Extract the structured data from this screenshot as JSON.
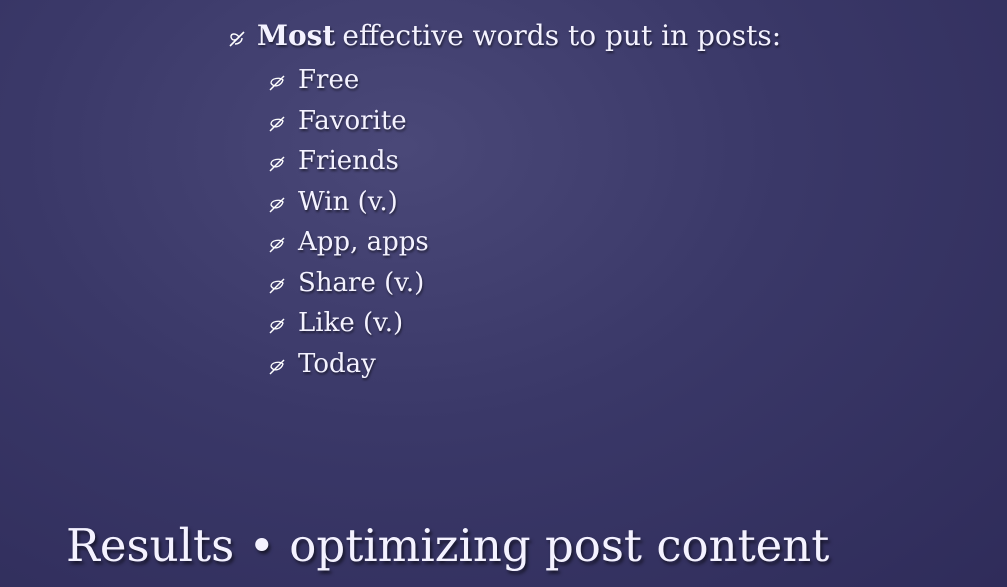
{
  "bullet": {
    "icon": "leaf-bullet-icon",
    "emphasis": "Most",
    "text": "effective words to put in posts:"
  },
  "sub_bullets": [
    {
      "icon": "leaf-bullet-icon",
      "text": "Free"
    },
    {
      "icon": "leaf-bullet-icon",
      "text": "Favorite"
    },
    {
      "icon": "leaf-bullet-icon",
      "text": "Friends"
    },
    {
      "icon": "leaf-bullet-icon",
      "text": "Win (v.)"
    },
    {
      "icon": "leaf-bullet-icon",
      "text": "App, apps"
    },
    {
      "icon": "leaf-bullet-icon",
      "text": "Share (v.)"
    },
    {
      "icon": "leaf-bullet-icon",
      "text": "Like (v.)"
    },
    {
      "icon": "leaf-bullet-icon",
      "text": "Today"
    }
  ],
  "title": "Results • optimizing post content",
  "colors": {
    "background": "#3a3868",
    "text": "#f4f2ff"
  }
}
